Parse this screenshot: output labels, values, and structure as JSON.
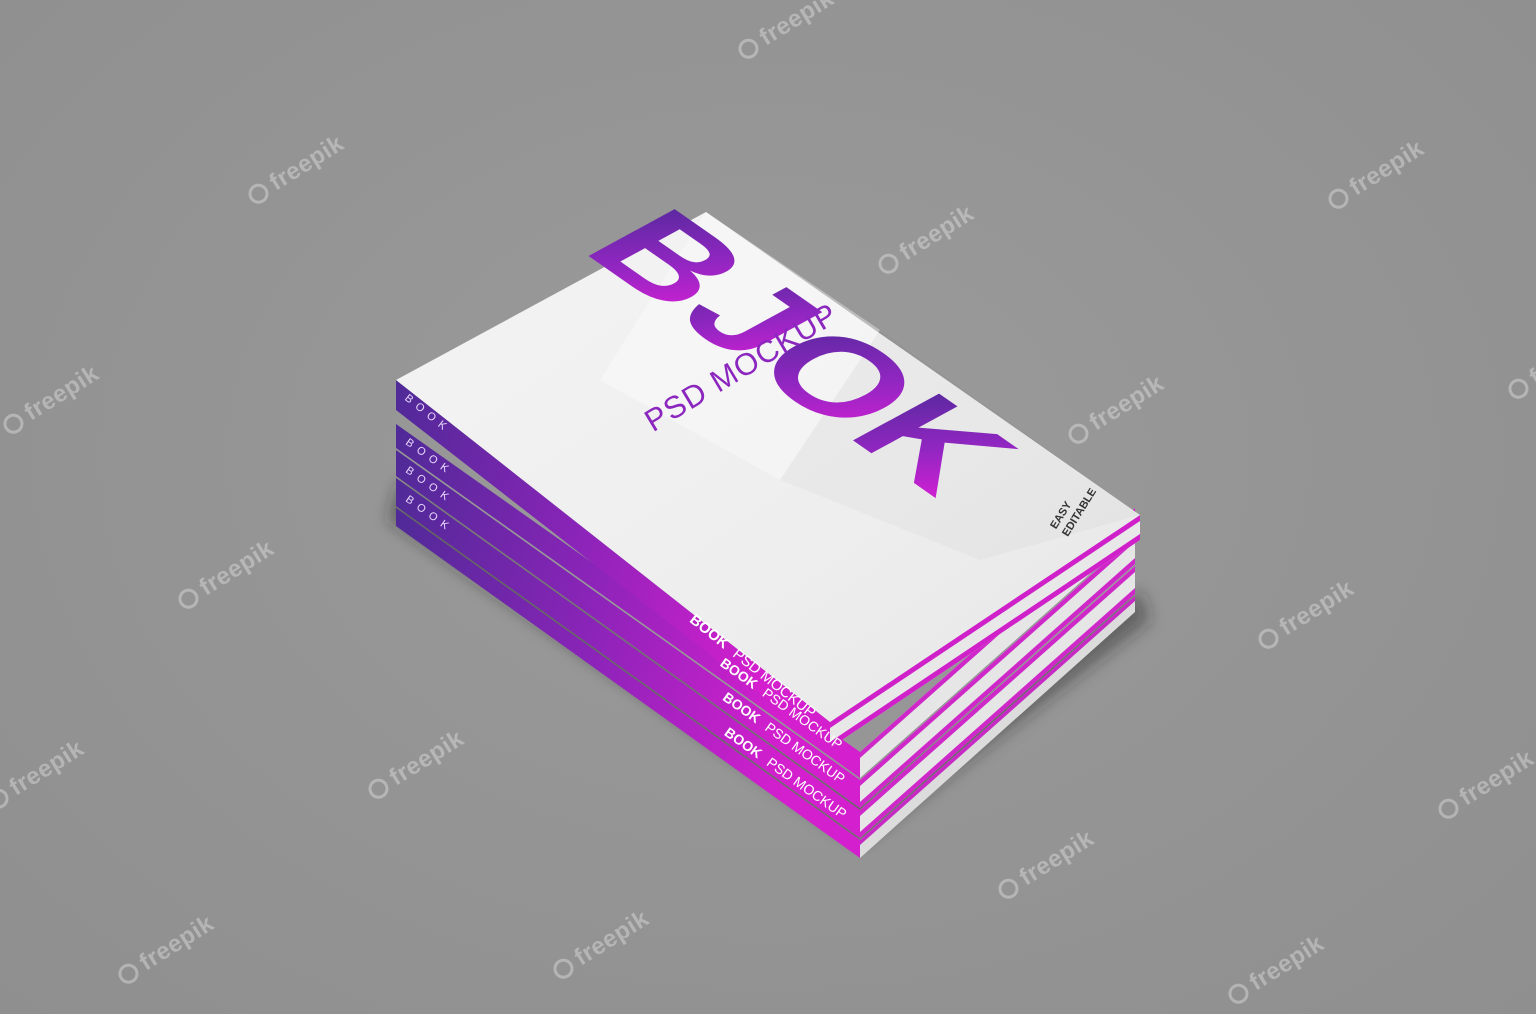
{
  "watermark": {
    "text": "freepik"
  },
  "book": {
    "cover_letters": [
      "B",
      "J",
      "O",
      "K"
    ],
    "cover_subtitle": "PSD MOCKUP",
    "cover_note_line1": "EASY",
    "cover_note_line2": "EDITABLE",
    "spine_side_text": "BOOK",
    "spine_title_bold": "BOOK",
    "spine_title_rest": "PSD MOCKUP",
    "stack_count": 4
  },
  "colors": {
    "background": "#949494",
    "gradient_purple": "#5b2a9e",
    "gradient_magenta": "#d41fce",
    "cover_white": "#f1f1f1",
    "pages": "#e9e9e9"
  }
}
